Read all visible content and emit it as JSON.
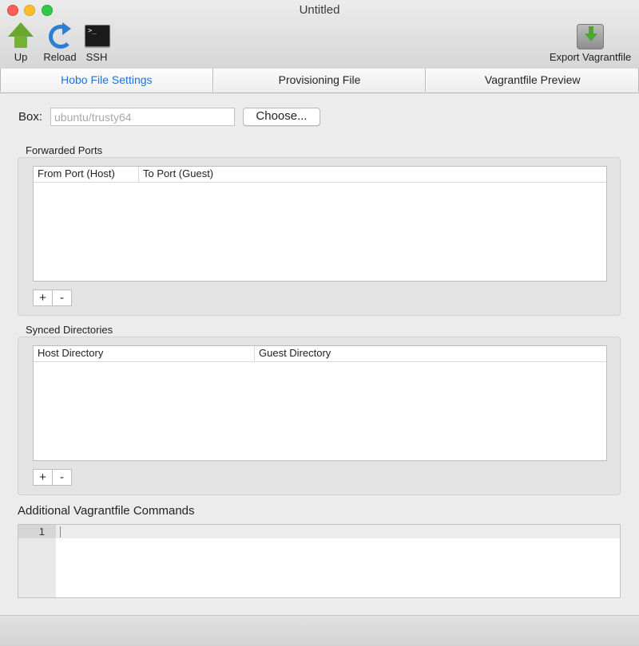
{
  "window": {
    "title": "Untitled"
  },
  "toolbar": {
    "up_label": "Up",
    "reload_label": "Reload",
    "ssh_label": "SSH",
    "ssh_prompt": ">_",
    "export_label": "Export Vagrantfile"
  },
  "tabs": [
    {
      "label": "Hobo File Settings",
      "active": true
    },
    {
      "label": "Provisioning File",
      "active": false
    },
    {
      "label": "Vagrantfile Preview",
      "active": false
    }
  ],
  "box": {
    "label": "Box:",
    "placeholder": "ubuntu/trusty64",
    "value": "",
    "choose_label": "Choose..."
  },
  "forwarded_ports": {
    "title": "Forwarded Ports",
    "columns": [
      "From Port (Host)",
      "To Port (Guest)"
    ],
    "rows": [],
    "add_label": "+",
    "remove_label": "-"
  },
  "synced_directories": {
    "title": "Synced Directories",
    "columns": [
      "Host Directory",
      "Guest Directory"
    ],
    "rows": [],
    "add_label": "+",
    "remove_label": "-"
  },
  "commands": {
    "title": "Additional Vagrantfile Commands",
    "line_number": "1"
  },
  "colors": {
    "accent": "#1a73d9",
    "close": "#fc5f57",
    "minimize": "#fdbc2e",
    "maximize": "#34c84a"
  }
}
